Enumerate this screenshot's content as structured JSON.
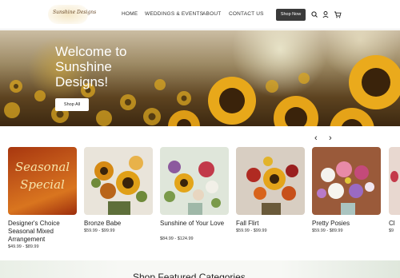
{
  "header": {
    "logo_text": "Sunshine Designs",
    "nav": [
      "HOME",
      "WEDDINGS & EVENTS",
      "ABOUT",
      "CONTACT US"
    ],
    "shop_now_label": "Shop Now",
    "icons": [
      "search-icon",
      "account-icon",
      "cart-icon"
    ]
  },
  "hero": {
    "heading": "Welcome to Sunshine Designs!",
    "button_label": "Shop All"
  },
  "carousel": {
    "prev": "‹",
    "next": "›",
    "products": [
      {
        "title": "Designer's Choice Seasonal Mixed Arrangement",
        "price": "$49.99 - $89.99",
        "image_text": "Seasonal Special"
      },
      {
        "title": "Bronze Babe",
        "price": "$59.99 - $99.99"
      },
      {
        "title": "Sunshine of Your Love",
        "price": "$84.99 - $124.99"
      },
      {
        "title": "Fall Flirt",
        "price": "$59.99 - $99.99"
      },
      {
        "title": "Pretty Posies",
        "price": "$59.99 - $89.99"
      },
      {
        "title": "Cl",
        "price": "$9"
      }
    ]
  },
  "featured": {
    "title": "Shop Featured Categories"
  }
}
